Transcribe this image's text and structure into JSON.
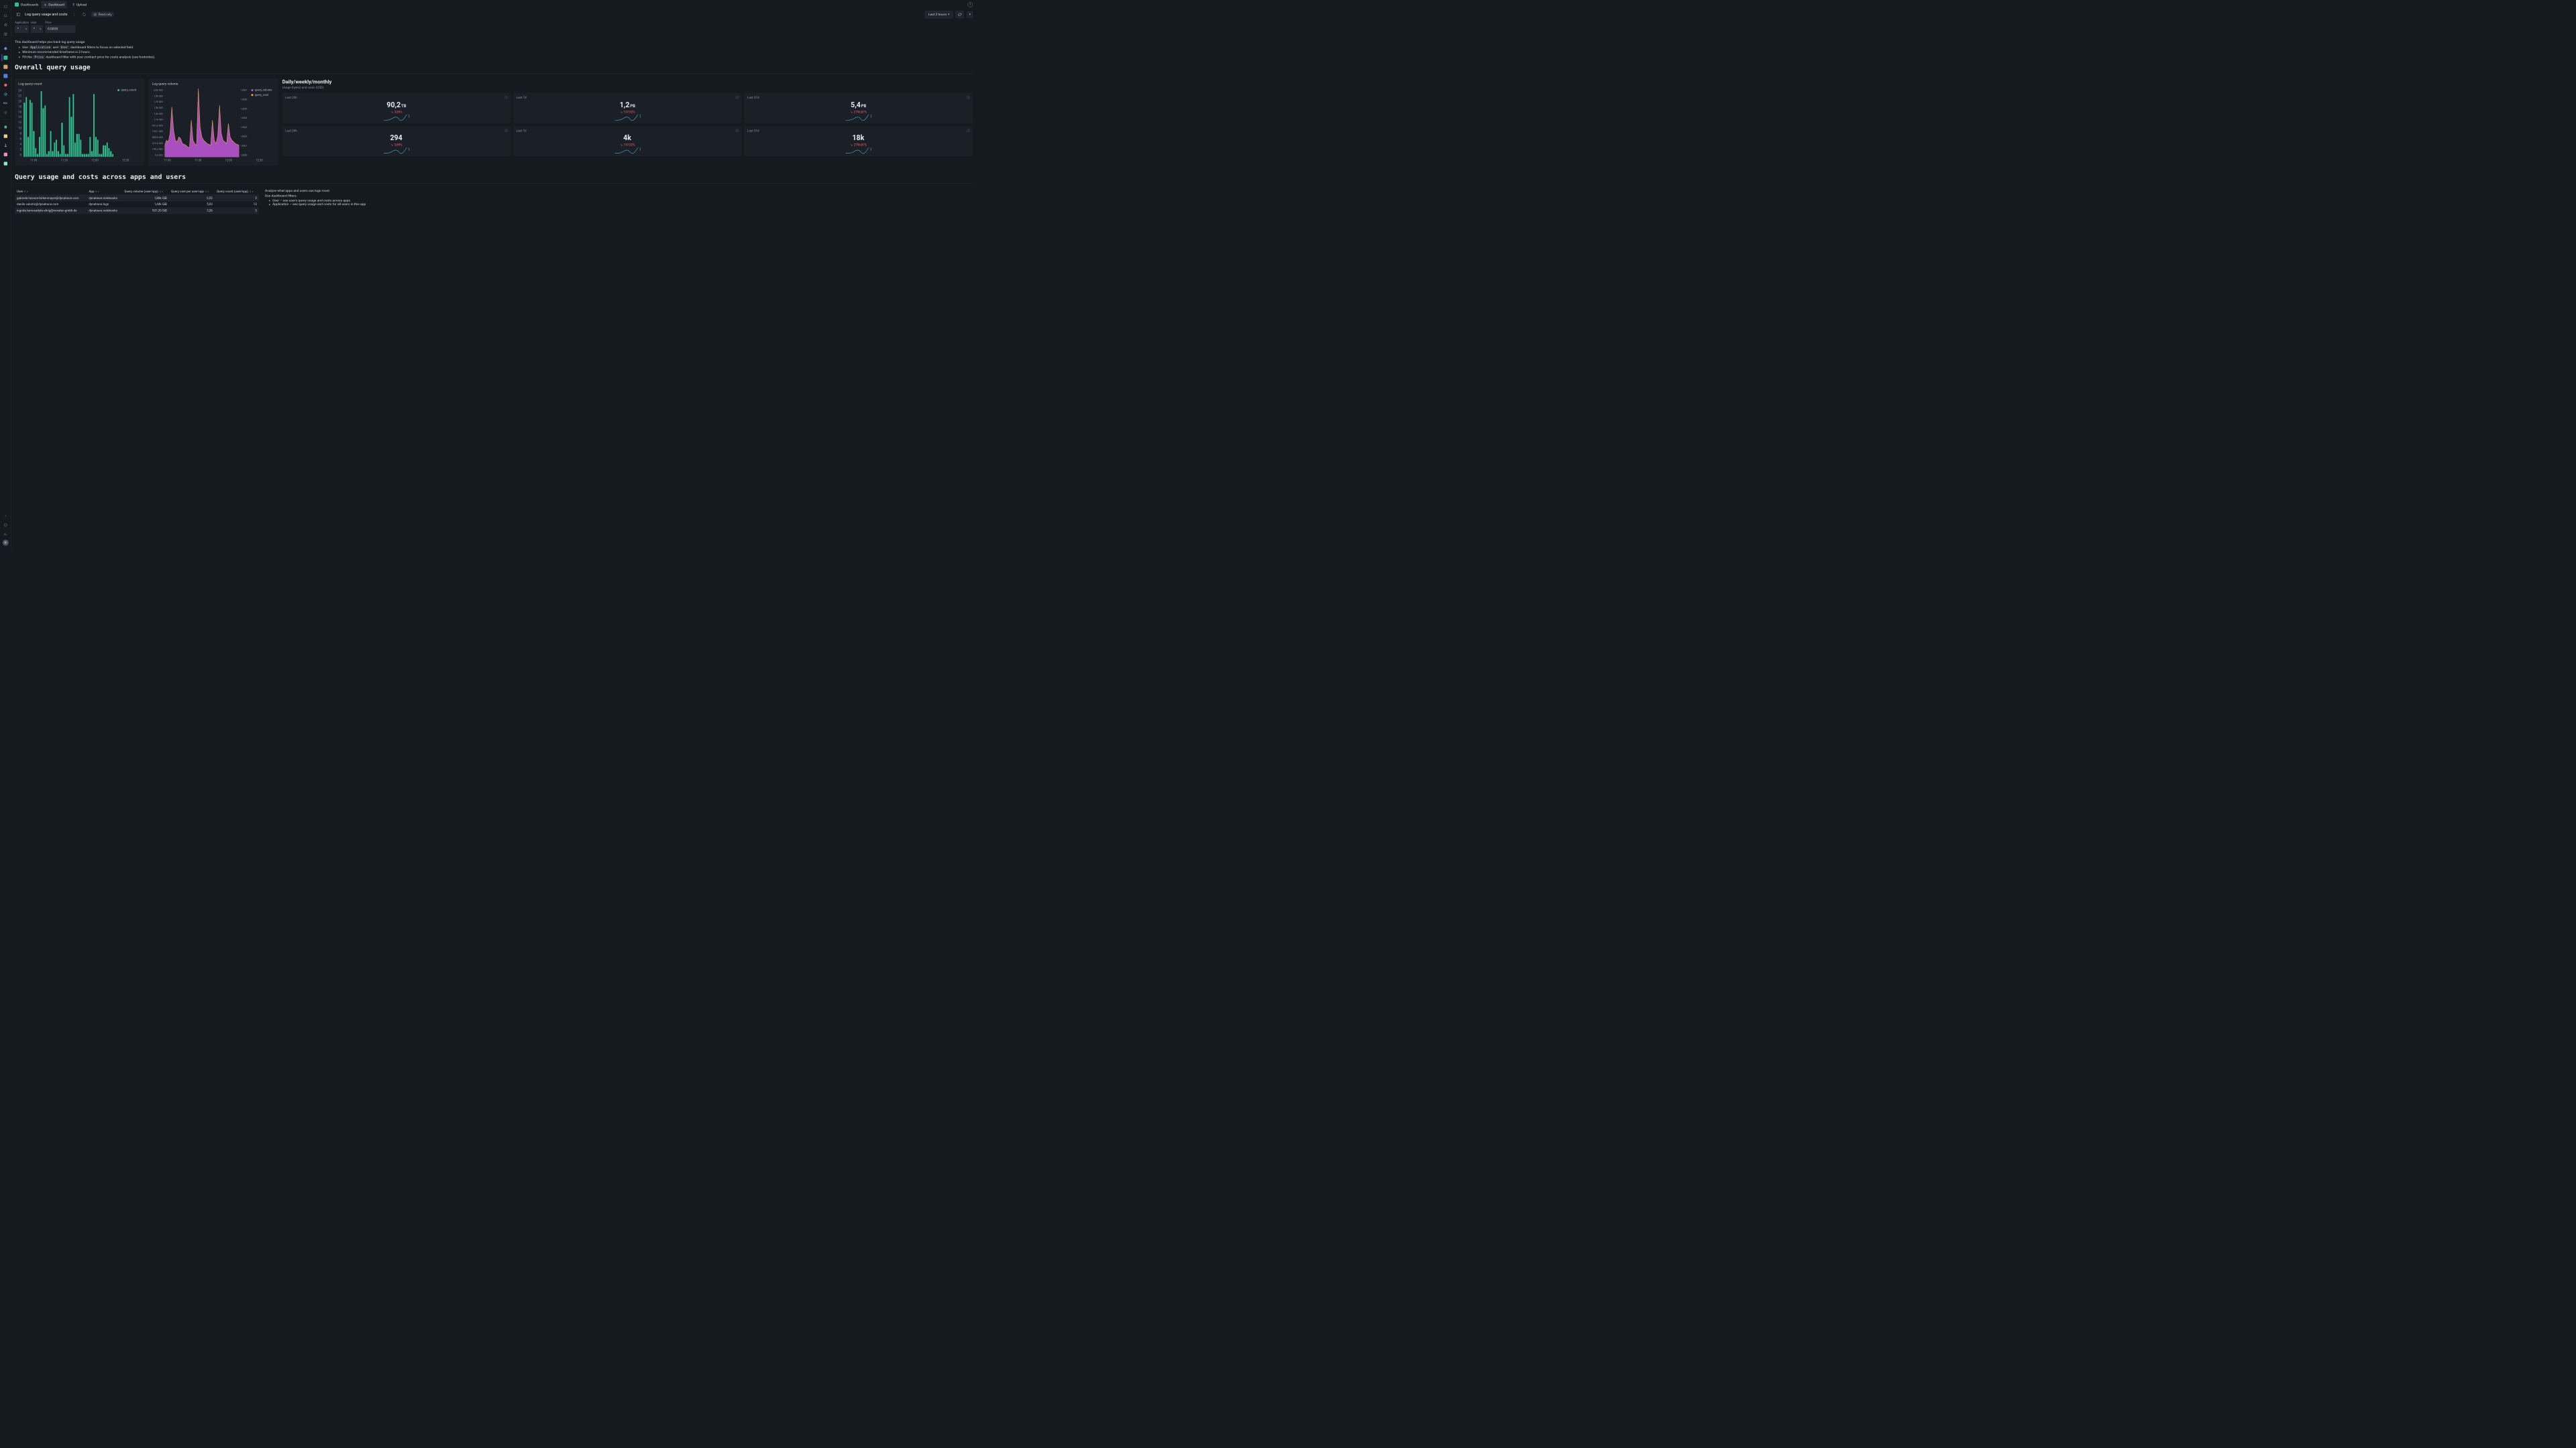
{
  "breadcrumb": {
    "root": "Dashboards"
  },
  "topbar": {
    "dashboard_btn": "Dashboard",
    "upload_btn": "Upload"
  },
  "subbar": {
    "title": "Log query usage and costs",
    "readonly": "Read only",
    "timerange": "Last 2 hours"
  },
  "filters": {
    "application_label": "Application",
    "application_value": "*",
    "user_label": "User",
    "user_value": "*",
    "price_label": "Price",
    "price_value": "0.0035"
  },
  "desc": {
    "intro": "This dashboard helps you track log query usage.",
    "li1_a": "Use ",
    "li1_app": "Application",
    "li1_b": " and ",
    "li1_user": "User",
    "li1_c": " dashboard filters to focus on selected field.",
    "li2": "Minimum recommended timeframe is 2 hours.",
    "li3_a": "Fill the ",
    "li3_price": "Price",
    "li3_b": " dashboard filter with your contract price for costs analysis (see footnotes)."
  },
  "section1_heading": "Overall query usage",
  "chart1": {
    "title": "Log query count",
    "legend": "query_count"
  },
  "chart2": {
    "title": "Log query volume",
    "legend1": "query_volume",
    "legend2": "query_cost"
  },
  "stats_heading": {
    "title": "Daily/weekly/monthly",
    "subtitle": "Usage (bytes) and costs (USD)"
  },
  "stats": [
    {
      "label": "Last 24h",
      "value": "90,2",
      "unit": "TB",
      "change": "3,89%"
    },
    {
      "label": "Last 7d",
      "value": "1,2",
      "unit": "PB",
      "change": "157,02%"
    },
    {
      "label": "Last 31d",
      "value": "5,4",
      "unit": "PB",
      "change": "2796,87%"
    },
    {
      "label": "Last 24h",
      "value": "294",
      "unit": "",
      "change": "3,89%"
    },
    {
      "label": "Last 7d",
      "value": "4k",
      "unit": "",
      "change": "157,02%"
    },
    {
      "label": "Last 31d",
      "value": "18k",
      "unit": "",
      "change": "2796,87%"
    }
  ],
  "section2_heading": "Query usage and costs across apps and users",
  "table": {
    "headers": [
      "User",
      "App",
      "Query volume (user/app)",
      "Query cost per user/app",
      "Query count (user/app)"
    ],
    "rows": [
      [
        "gabriele.hasson-birkenmayer@dynatrace.com",
        "dynatrace.notebooks",
        "1,86k GiB",
        "6,52",
        "5"
      ],
      [
        "danilo.vukotic@dynatrace.com",
        "dynatrace.logs",
        "1,44k GiB",
        "5,03",
        "12"
      ],
      [
        "ingrida.tamosaityte-ehrig@novatec-gmbh.de",
        "dynatrace.notebooks",
        "931,35 GiB",
        "3,26",
        "3"
      ]
    ]
  },
  "analyze": {
    "p1": "Analyze what apps and users use logs most.",
    "p2": "Use dashboard filters:",
    "li1_a": "User",
    "li1_b": " – see user's query usage and costs across apps",
    "li2_a": "Application",
    "li2_b": " – see query usage and costs for all users in this app"
  },
  "chart_data": [
    {
      "type": "bar",
      "title": "Log query count",
      "series_name": "query_count",
      "x_ticks": [
        "11:00",
        "11:30",
        "12:00",
        "12:30"
      ],
      "y_ticks": [
        0,
        2,
        4,
        6,
        8,
        10,
        12,
        14,
        16,
        18,
        20,
        22,
        24
      ],
      "ylim": [
        0,
        24
      ],
      "values": [
        19,
        21,
        7,
        20,
        19,
        9,
        3,
        1,
        7,
        23,
        17,
        18,
        1,
        2,
        9,
        2,
        5,
        6,
        2,
        1,
        12,
        4,
        1,
        1,
        21,
        14,
        22,
        5,
        8,
        8,
        6,
        1,
        1,
        1,
        1,
        7,
        2,
        22,
        7,
        6,
        1,
        1,
        4,
        4,
        5,
        3,
        2,
        1
      ],
      "color": "#2fbf8f"
    },
    {
      "type": "area",
      "title": "Log query volume",
      "x_ticks": [
        "11:00",
        "11:30",
        "12:00",
        "12:30"
      ],
      "y_left_ticks": [
        "0,0 GiB",
        "186,3 GiB",
        "372,5 GiB",
        "558,8 GiB",
        "745,1 GiB",
        "931,3 GiB",
        "1,1k GiB",
        "1,3k GiB",
        "1,5k GiB",
        "1,7k GiB",
        "1,9k GiB",
        "2,0k GiB"
      ],
      "y_right_ticks": [
        "US$0",
        "US$1",
        "US$2",
        "US$3",
        "US$4",
        "US$5",
        "US$6",
        "US$7"
      ],
      "series": [
        {
          "name": "query_volume",
          "color": "#c358d9",
          "values": [
            350,
            500,
            450,
            700,
            1500,
            800,
            500,
            450,
            600,
            550,
            400,
            380,
            350,
            300,
            280,
            1100,
            500,
            400,
            350,
            2050,
            900,
            600,
            500,
            450,
            400,
            380,
            350,
            1100,
            500,
            400,
            630,
            1550,
            700,
            500,
            450,
            400,
            1000,
            600,
            500,
            450,
            400,
            380,
            350
          ]
        },
        {
          "name": "query_cost",
          "color": "#f0a74a",
          "values": [
            1.2,
            1.8,
            1.6,
            2.4,
            5.2,
            2.8,
            1.8,
            1.6,
            2.1,
            1.9,
            1.4,
            1.3,
            1.2,
            1.0,
            1.0,
            3.8,
            1.8,
            1.4,
            1.2,
            7.0,
            3.1,
            2.1,
            1.8,
            1.6,
            1.4,
            1.3,
            1.2,
            3.8,
            1.8,
            1.4,
            2.2,
            5.4,
            2.4,
            1.8,
            1.6,
            1.4,
            3.5,
            2.1,
            1.8,
            1.6,
            1.4,
            1.3,
            1.2
          ]
        }
      ]
    }
  ],
  "colors": {
    "accent_green": "#2fbf8f",
    "accent_magenta": "#c358d9",
    "accent_orange": "#f0a74a",
    "down_red": "#ff5e6c",
    "spark_teal": "#4fb8c9"
  }
}
